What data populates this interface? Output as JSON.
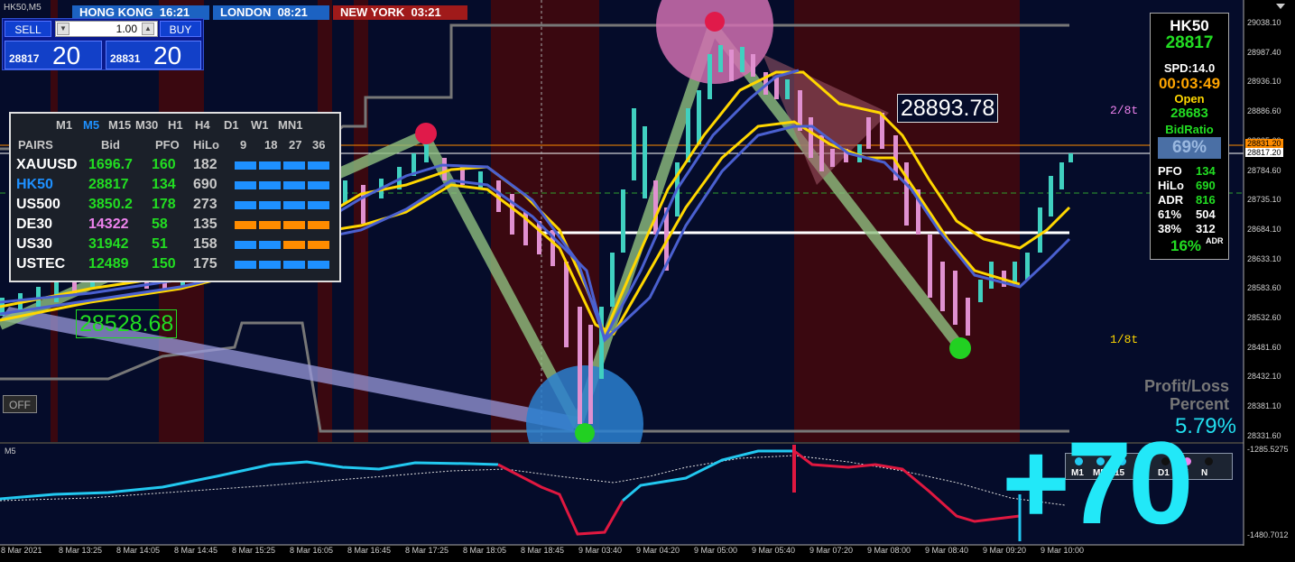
{
  "symbol_title": "HK50,M5",
  "clocks": [
    {
      "label": "HONG KONG",
      "time": "16:21",
      "color": "#1c62c2"
    },
    {
      "label": "LONDON",
      "time": "08:21",
      "color": "#1c62c2"
    },
    {
      "label": "NEW YORK",
      "time": "03:21",
      "color": "#a01a1a"
    }
  ],
  "trade_panel": {
    "sell_label": "SELL",
    "buy_label": "BUY",
    "lot_value": "1.00",
    "bid_small": "28817",
    "bid_big": "20",
    "ask_small": "28831",
    "ask_big": "20"
  },
  "dashboard": {
    "timeframes": [
      "M1",
      "M5",
      "M15",
      "M30",
      "H1",
      "H4",
      "D1",
      "W1",
      "MN1"
    ],
    "active_timeframe": "M5",
    "col_headers": [
      "PAIRS",
      "Bid",
      "PFO",
      "HiLo",
      "9",
      "18",
      "27",
      "36"
    ],
    "rows": [
      {
        "pair": "XAUUSD",
        "bid": "1696.7",
        "pfo": "160",
        "hilo": "182",
        "pair_color": "#ffffff",
        "bid_color": "#22dd22",
        "bars": [
          "#1e90ff",
          "#1e90ff",
          "#1e90ff",
          "#1e90ff"
        ]
      },
      {
        "pair": "HK50",
        "bid": "28817",
        "pfo": "134",
        "hilo": "690",
        "pair_color": "#1e90ff",
        "bid_color": "#22dd22",
        "bars": [
          "#1e90ff",
          "#1e90ff",
          "#1e90ff",
          "#1e90ff"
        ]
      },
      {
        "pair": "US500",
        "bid": "3850.2",
        "pfo": "178",
        "hilo": "273",
        "pair_color": "#ffffff",
        "bid_color": "#22dd22",
        "bars": [
          "#1e90ff",
          "#1e90ff",
          "#1e90ff",
          "#1e90ff"
        ]
      },
      {
        "pair": "DE30",
        "bid": "14322",
        "pfo": "58",
        "hilo": "135",
        "pair_color": "#ffffff",
        "bid_color": "#ee82ee",
        "bars": [
          "#ff8c00",
          "#ff8c00",
          "#ff8c00",
          "#ff8c00"
        ]
      },
      {
        "pair": "US30",
        "bid": "31942",
        "pfo": "51",
        "hilo": "158",
        "pair_color": "#ffffff",
        "bid_color": "#22dd22",
        "bars": [
          "#1e90ff",
          "#1e90ff",
          "#ff8c00",
          "#ff8c00"
        ]
      },
      {
        "pair": "USTEC",
        "bid": "12489",
        "pfo": "150",
        "hilo": "175",
        "pair_color": "#ffffff",
        "bid_color": "#22dd22",
        "bars": [
          "#1e90ff",
          "#1e90ff",
          "#1e90ff",
          "#1e90ff"
        ]
      }
    ]
  },
  "info_panel": {
    "symbol": "HK50",
    "price": "28817",
    "spread": "SPD:14.0",
    "timer": "00:03:49",
    "open_label": "Open",
    "open_value": "28683",
    "bidratio_label": "BidRatio",
    "bidratio_value": "69%",
    "stats": [
      {
        "label": "PFO",
        "value": "134"
      },
      {
        "label": "HiLo",
        "value": "690"
      },
      {
        "label": "ADR",
        "value": "816"
      },
      {
        "label": "61%",
        "value": "504"
      },
      {
        "label": "38%",
        "value": "312"
      }
    ],
    "adr_percent": "16%",
    "adr_suffix": "ADR"
  },
  "labels": {
    "price_label_top": "28893.78",
    "price_label_bottom": "28528.68",
    "eighth_top": "2/8t",
    "eighth_bottom": "1/8t",
    "profit_loss_line1": "Profit/Loss",
    "profit_loss_line2": "Percent",
    "profit_loss_value": "5.79%",
    "big_number": "+70",
    "off_button": "OFF",
    "sub_window_label": "M5"
  },
  "price_axis": [
    "29038.10",
    "28987.40",
    "28936.10",
    "28886.60",
    "28835.60",
    "28784.60",
    "28735.10",
    "28684.10",
    "28633.10",
    "28583.60",
    "28532.60",
    "28481.60",
    "28432.10",
    "28381.10",
    "28331.60"
  ],
  "price_tags": [
    {
      "value": "28831.20",
      "color": "#ff8c00"
    },
    {
      "value": "28817.20",
      "color": "#ffffff"
    }
  ],
  "sub_axis": {
    "top": "-1285.5275",
    "bottom": "-1480.7012"
  },
  "time_axis": [
    "8 Mar 2021",
    "8 Mar 13:25",
    "8 Mar 14:05",
    "8 Mar 14:45",
    "8 Mar 15:25",
    "8 Mar 16:05",
    "8 Mar 16:45",
    "8 Mar 17:25",
    "8 Mar 18:05",
    "8 Mar 18:45",
    "9 Mar 03:40",
    "9 Mar 04:20",
    "9 Mar 05:00",
    "9 Mar 05:40",
    "9 Mar 07:20",
    "9 Mar 08:00",
    "9 Mar 08:40",
    "9 Mar 09:20",
    "9 Mar 10:00"
  ],
  "tf_bar": [
    "M1",
    "M5",
    "15",
    "H1",
    "D1",
    "W",
    "N"
  ],
  "colors": {
    "session_red": "#3a0810",
    "session_dark": "#050c2a",
    "yellow_band": "#ffd700",
    "blue_band": "#4a60d0",
    "up_candle": "#40d0c0",
    "down_candle": "#e090d0",
    "sub_cyan": "#22c8f0",
    "sub_red": "#e01840"
  }
}
